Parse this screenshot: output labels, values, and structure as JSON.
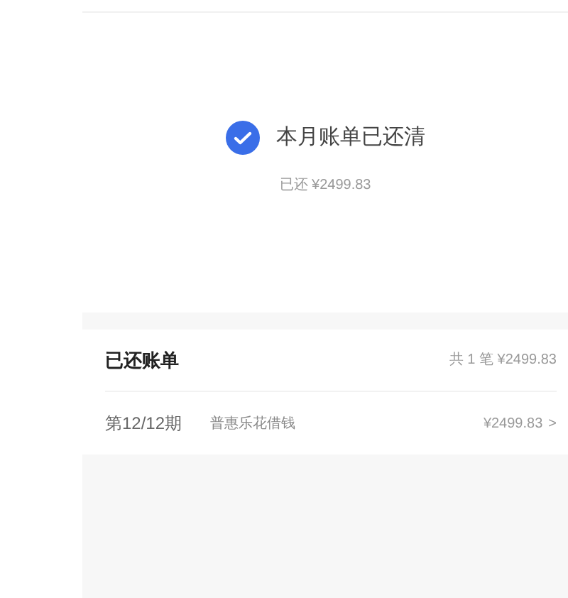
{
  "status": {
    "paid": true,
    "title": "本月账单已还清",
    "paid_amount": "已还 ¥2499.83"
  },
  "bills": {
    "title": "已还账单",
    "summary": "共 1 笔 ¥2499.83",
    "items": [
      {
        "period": "第12/12期",
        "name": "普惠乐花借钱",
        "amount": "¥2499.83",
        "chevron": ">"
      }
    ]
  }
}
